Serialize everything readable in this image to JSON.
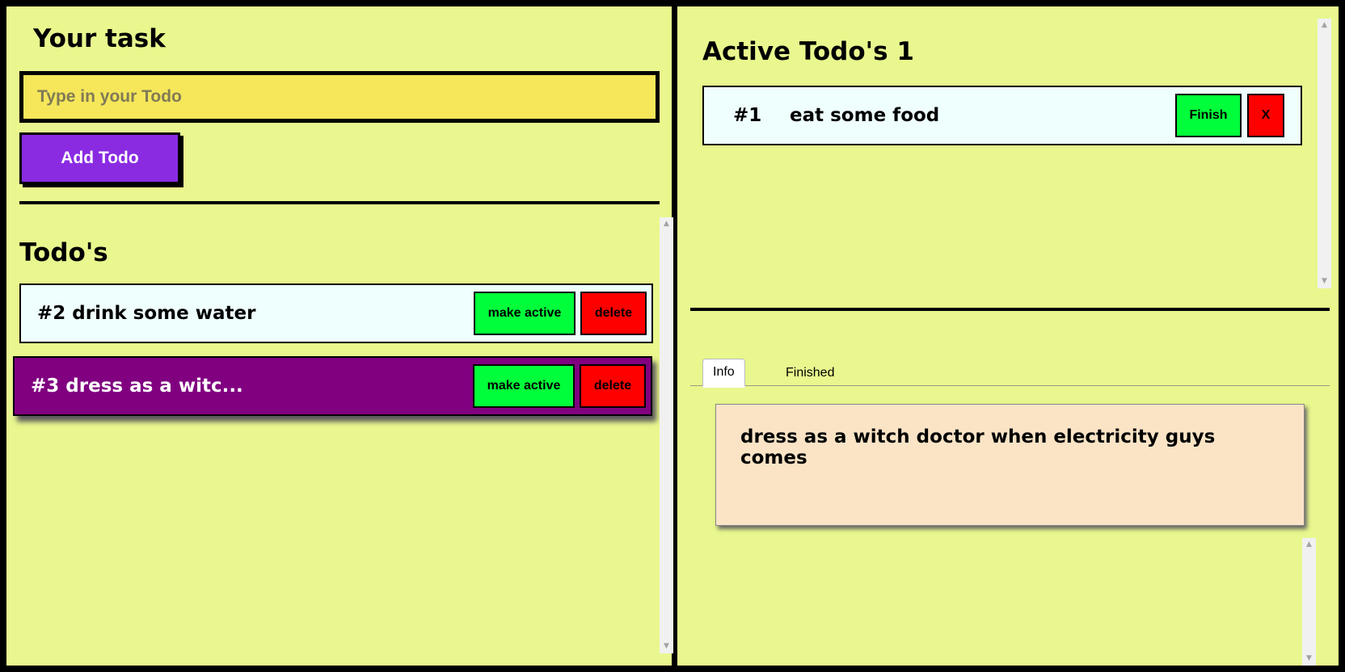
{
  "input_panel": {
    "title": "Your task",
    "input_placeholder": "Type in your Todo",
    "add_button": "Add Todo"
  },
  "todos": {
    "title": "Todo's",
    "items": [
      {
        "label": "#2  drink some water",
        "make_active": "make active",
        "delete": "delete"
      },
      {
        "label": "#3  dress as a witc...",
        "make_active": "make active",
        "delete": "delete"
      }
    ]
  },
  "active": {
    "title": "Active Todo's 1",
    "item": {
      "number": "#1",
      "text": "eat some food",
      "finish": "Finish",
      "remove": "X"
    }
  },
  "detail_tabs": {
    "tabs": [
      "Info",
      "Finished"
    ],
    "selected": "Info",
    "info_text": "dress as a witch doctor when electricity guys comes"
  },
  "colors": {
    "background": "#e9f78e",
    "input": "#f5e65a",
    "add_button": "#8a2be2",
    "selected_todo": "#800080",
    "green_button": "#00ff3a",
    "red_button": "#ff0000",
    "info_card": "#fbe4c6"
  }
}
